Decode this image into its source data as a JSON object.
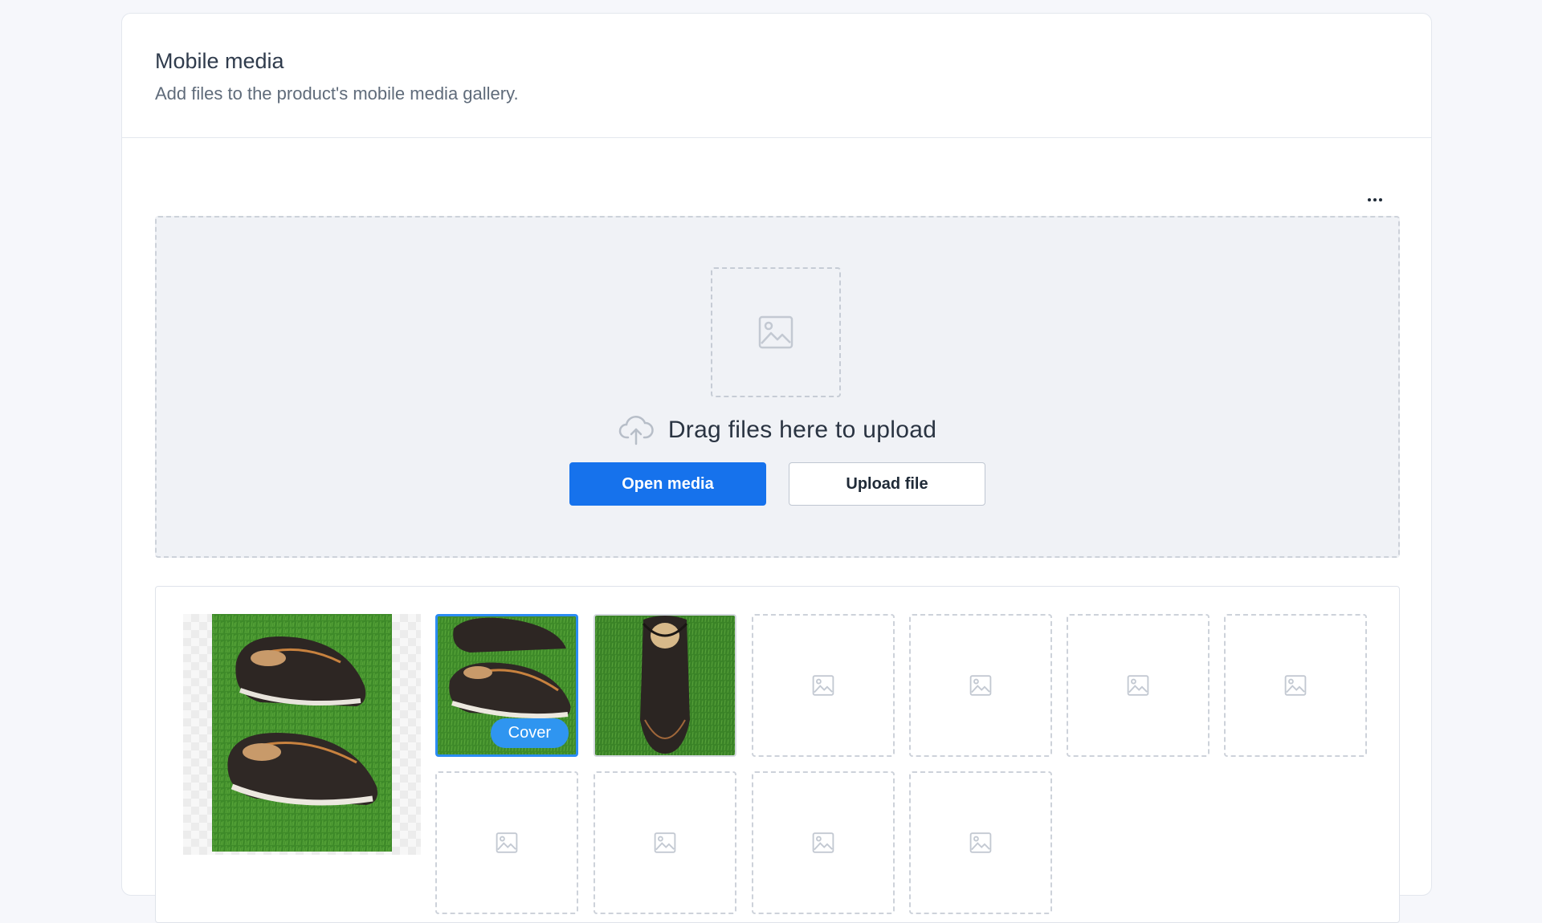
{
  "section": {
    "title": "Mobile media",
    "subtitle": "Add files to the product's mobile media gallery."
  },
  "toolbar": {
    "more_icon": "ellipsis-icon"
  },
  "dropzone": {
    "placeholder_icon": "image-icon",
    "upload_icon": "cloud-upload-icon",
    "text": "Drag files here to upload",
    "open_media_label": "Open media",
    "upload_file_label": "Upload file"
  },
  "gallery": {
    "cover_label": "Cover",
    "thumbnails": [
      {
        "state": "selected",
        "content": "two brown boat shoes on grass",
        "is_cover": true
      },
      {
        "state": "filled",
        "content": "black loafer on grass",
        "is_cover": false
      },
      {
        "state": "empty"
      },
      {
        "state": "empty"
      },
      {
        "state": "empty"
      },
      {
        "state": "empty"
      },
      {
        "state": "empty"
      },
      {
        "state": "empty"
      },
      {
        "state": "empty"
      },
      {
        "state": "empty"
      }
    ]
  },
  "colors": {
    "primary": "#1672ec",
    "selected_border": "#2b8cf2",
    "cover_badge": "#2f95f0",
    "grass": "#3f8a2a"
  }
}
